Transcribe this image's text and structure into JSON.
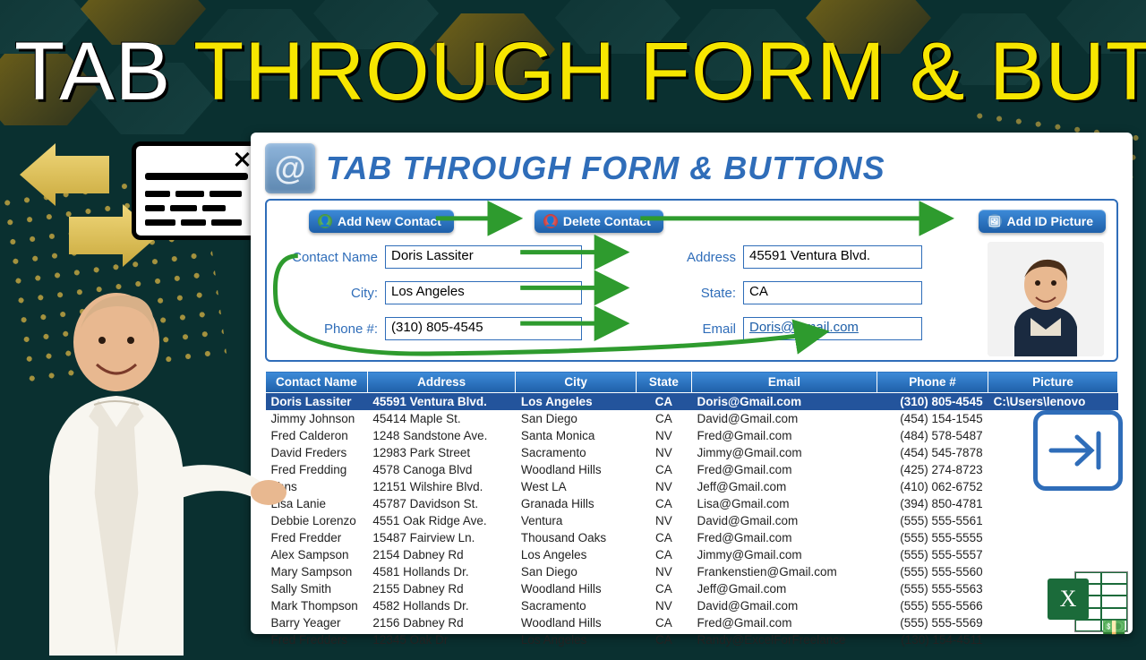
{
  "headline": {
    "word1": "TAB",
    "rest": "THROUGH FORM & BUTTONS"
  },
  "panel": {
    "title": "TAB THROUGH FORM & BUTTONS",
    "icon_char": "@",
    "buttons": {
      "add": "Add New Contact",
      "delete": "Delete Contact",
      "picture": "Add ID Picture"
    },
    "labels": {
      "contact_name": "Contact Name",
      "address": "Address",
      "city": "City:",
      "state": "State:",
      "phone": "Phone #:",
      "email": "Email"
    },
    "values": {
      "contact_name": "Doris Lassiter",
      "address": "45591 Ventura Blvd.",
      "city": "Los Angeles",
      "state": "CA",
      "phone": "(310) 805-4545",
      "email": "Doris@Gmail.com"
    }
  },
  "columns": [
    "Contact Name",
    "Address",
    "City",
    "State",
    "Email",
    "Phone #",
    "Picture"
  ],
  "rows": [
    {
      "name": "Doris Lassiter",
      "address": "45591 Ventura Blvd.",
      "city": "Los Angeles",
      "state": "CA",
      "email": "Doris@Gmail.com",
      "phone": "(310) 805-4545",
      "picture": "C:\\Users\\lenovo"
    },
    {
      "name": "Jimmy Johnson",
      "address": "45414 Maple St.",
      "city": "San Diego",
      "state": "CA",
      "email": "David@Gmail.com",
      "phone": "(454) 154-1545",
      "picture": ""
    },
    {
      "name": "Fred Calderon",
      "address": "1248 Sandstone Ave.",
      "city": "Santa Monica",
      "state": "NV",
      "email": "Fred@Gmail.com",
      "phone": "(484) 578-5487",
      "picture": ""
    },
    {
      "name": "David Freders",
      "address": "12983 Park Street",
      "city": "Sacramento",
      "state": "NV",
      "email": "Jimmy@Gmail.com",
      "phone": "(454) 545-7878",
      "picture": ""
    },
    {
      "name": "Fred Fredding",
      "address": "4578 Canoga  Blvd",
      "city": "Woodland Hills",
      "state": "CA",
      "email": "Fred@Gmail.com",
      "phone": "(425) 274-8723",
      "picture": ""
    },
    {
      "name": "ohns",
      "address": "12151 Wilshire Blvd.",
      "city": "West LA",
      "state": "NV",
      "email": "Jeff@Gmail.com",
      "phone": "(410) 062-6752",
      "picture": ""
    },
    {
      "name": "Lisa Lanie",
      "address": "45787 Davidson St.",
      "city": "Granada Hills",
      "state": "CA",
      "email": "Lisa@Gmail.com",
      "phone": "(394) 850-4781",
      "picture": ""
    },
    {
      "name": "Debbie Lorenzo",
      "address": "4551 Oak Ridge Ave.",
      "city": "Ventura",
      "state": "NV",
      "email": "David@Gmail.com",
      "phone": "(555) 555-5561",
      "picture": ""
    },
    {
      "name": "Fred Fredder",
      "address": "15487 Fairview Ln.",
      "city": "Thousand Oaks",
      "state": "CA",
      "email": "Fred@Gmail.com",
      "phone": "(555) 555-5555",
      "picture": ""
    },
    {
      "name": "Alex Sampson",
      "address": "2154 Dabney Rd",
      "city": "Los Angeles",
      "state": "CA",
      "email": "Jimmy@Gmail.com",
      "phone": "(555) 555-5557",
      "picture": ""
    },
    {
      "name": "Mary Sampson",
      "address": "4581 Hollands Dr.",
      "city": "San Diego",
      "state": "NV",
      "email": "Frankenstien@Gmail.com",
      "phone": "(555) 555-5560",
      "picture": ""
    },
    {
      "name": "Sally Smith",
      "address": "2155 Dabney Rd",
      "city": "Woodland Hills",
      "state": "CA",
      "email": "Jeff@Gmail.com",
      "phone": "(555) 555-5563",
      "picture": ""
    },
    {
      "name": "Mark Thompson",
      "address": "4582 Hollands Dr.",
      "city": "Sacramento",
      "state": "NV",
      "email": "David@Gmail.com",
      "phone": "(555) 555-5566",
      "picture": ""
    },
    {
      "name": "Barry Yeager",
      "address": "2156 Dabney Rd",
      "city": "Woodland Hills",
      "state": "CA",
      "email": "Fred@Gmail.com",
      "phone": "(555) 555-5569",
      "picture": ""
    },
    {
      "name": "Fred Fredders",
      "address": "12345 Oak Dr",
      "city": "Los Angeles",
      "state": "CA",
      "email": "Randy@ExcelForFreelance",
      "phone": "(130) 154-4511",
      "picture": ""
    }
  ],
  "icons": {
    "left_arrow": "nav-arrow-left",
    "right_arrow": "nav-arrow-right",
    "form_window": "form-window-icon",
    "tab_key": "tab-key-icon",
    "excel": "excel-icon"
  }
}
